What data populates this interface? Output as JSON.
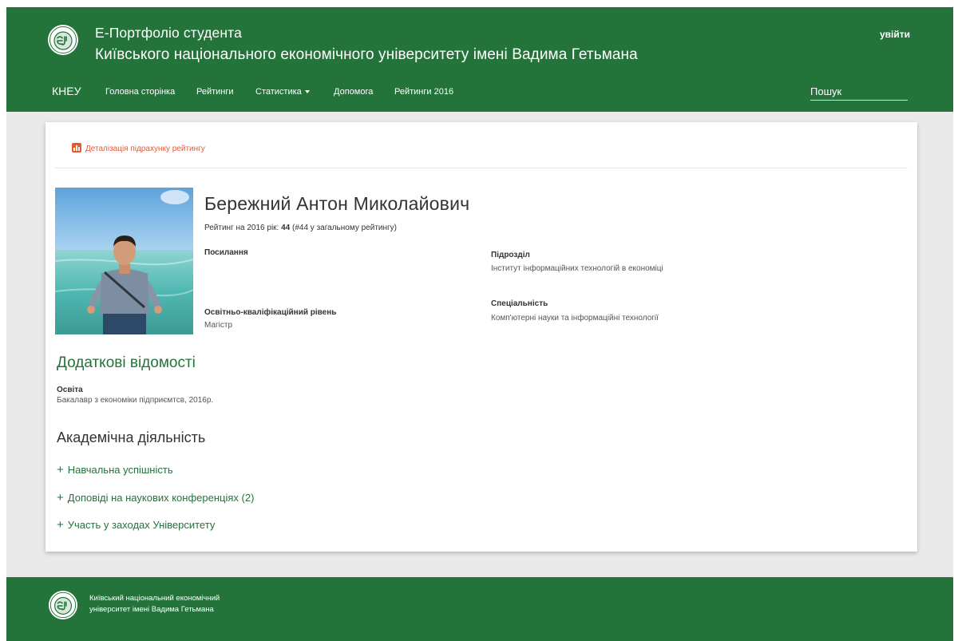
{
  "header": {
    "title_line1": "Е-Портфоліо студента",
    "title_line2": "Київського національного економічного університету імені Вадима Гетьмана",
    "login": "увійти",
    "brand": "КНЕУ",
    "nav": [
      {
        "label": "Головна сторінка"
      },
      {
        "label": "Рейтинги"
      },
      {
        "label": "Статистика"
      },
      {
        "label": "Допомога"
      },
      {
        "label": "Рейтинги 2016"
      }
    ],
    "search_placeholder": "Пошук"
  },
  "detail_link": "Деталізація підрахунку рейтингу",
  "profile": {
    "name": "Бережний Антон Миколайович",
    "rating_prefix": "Рейтинг на 2016 рік:",
    "rating_value": "44",
    "rating_suffix": "(#44 у загальному рейтингу)",
    "links_label": "Посилання",
    "department_label": "Підрозділ",
    "department_value": "Інститут інформаційних технологій в економіці",
    "level_label": "Освітньо-кваліфікаційний рівень",
    "level_value": "Магістр",
    "specialty_label": "Спеціальність",
    "specialty_value": "Комп'ютерні науки та інформаційні технології"
  },
  "extra": {
    "heading": "Додаткові відомості",
    "education_label": "Освіта",
    "education_value": "Бакалавр з економіки підприємтсв, 2016р."
  },
  "academic": {
    "heading": "Академічна діяльність",
    "sections": [
      {
        "label": "Навчальна успішність"
      },
      {
        "label": "Доповіді на наукових конференціях (2)"
      },
      {
        "label": "Участь у заходах Університету"
      }
    ]
  },
  "footer": {
    "line1": "Київський національний економічний",
    "line2": "університет імені Вадима Гетьмана"
  },
  "colors": {
    "brand_green": "#23733a",
    "accent_red": "#e8572d",
    "page_background": "#e9e9e9"
  }
}
